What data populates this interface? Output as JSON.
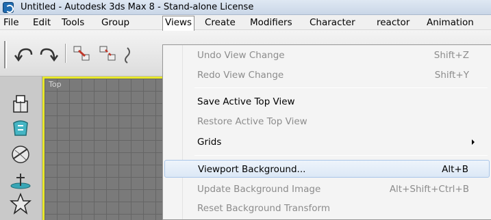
{
  "window": {
    "title": "Untitled - Autodesk 3ds Max 8  - Stand-alone License"
  },
  "menubar": {
    "items": [
      "File",
      "Edit",
      "Tools",
      "Group",
      "Views",
      "Create",
      "Modifiers",
      "Character",
      "reactor",
      "Animation"
    ],
    "active": "Views"
  },
  "viewport": {
    "label": "Top"
  },
  "views_menu": {
    "items": [
      {
        "label": "Undo View Change",
        "shortcut": "Shift+Z",
        "enabled": false
      },
      {
        "label": "Redo View Change",
        "shortcut": "Shift+Y",
        "enabled": false
      },
      {
        "label": "Save Active Top View",
        "shortcut": "",
        "enabled": true
      },
      {
        "label": "Restore Active Top View",
        "shortcut": "",
        "enabled": false
      },
      {
        "label": "Grids",
        "shortcut": "",
        "enabled": true,
        "submenu": true
      },
      {
        "label": "Viewport Background...",
        "shortcut": "Alt+B",
        "enabled": true,
        "highlighted": true
      },
      {
        "label": "Update Background Image",
        "shortcut": "Alt+Shift+Ctrl+B",
        "enabled": false
      },
      {
        "label": "Reset Background Transform",
        "shortcut": "",
        "enabled": false
      }
    ]
  },
  "icons": {
    "toolbar": [
      "undo-icon",
      "redo-icon",
      "select-and-link-icon",
      "unlink-selection-icon",
      "bind-to-space-warp-icon"
    ],
    "command_panel": [
      "create-icon",
      "modify-icon",
      "hierarchy-icon",
      "motion-icon",
      "display-icon"
    ]
  }
}
